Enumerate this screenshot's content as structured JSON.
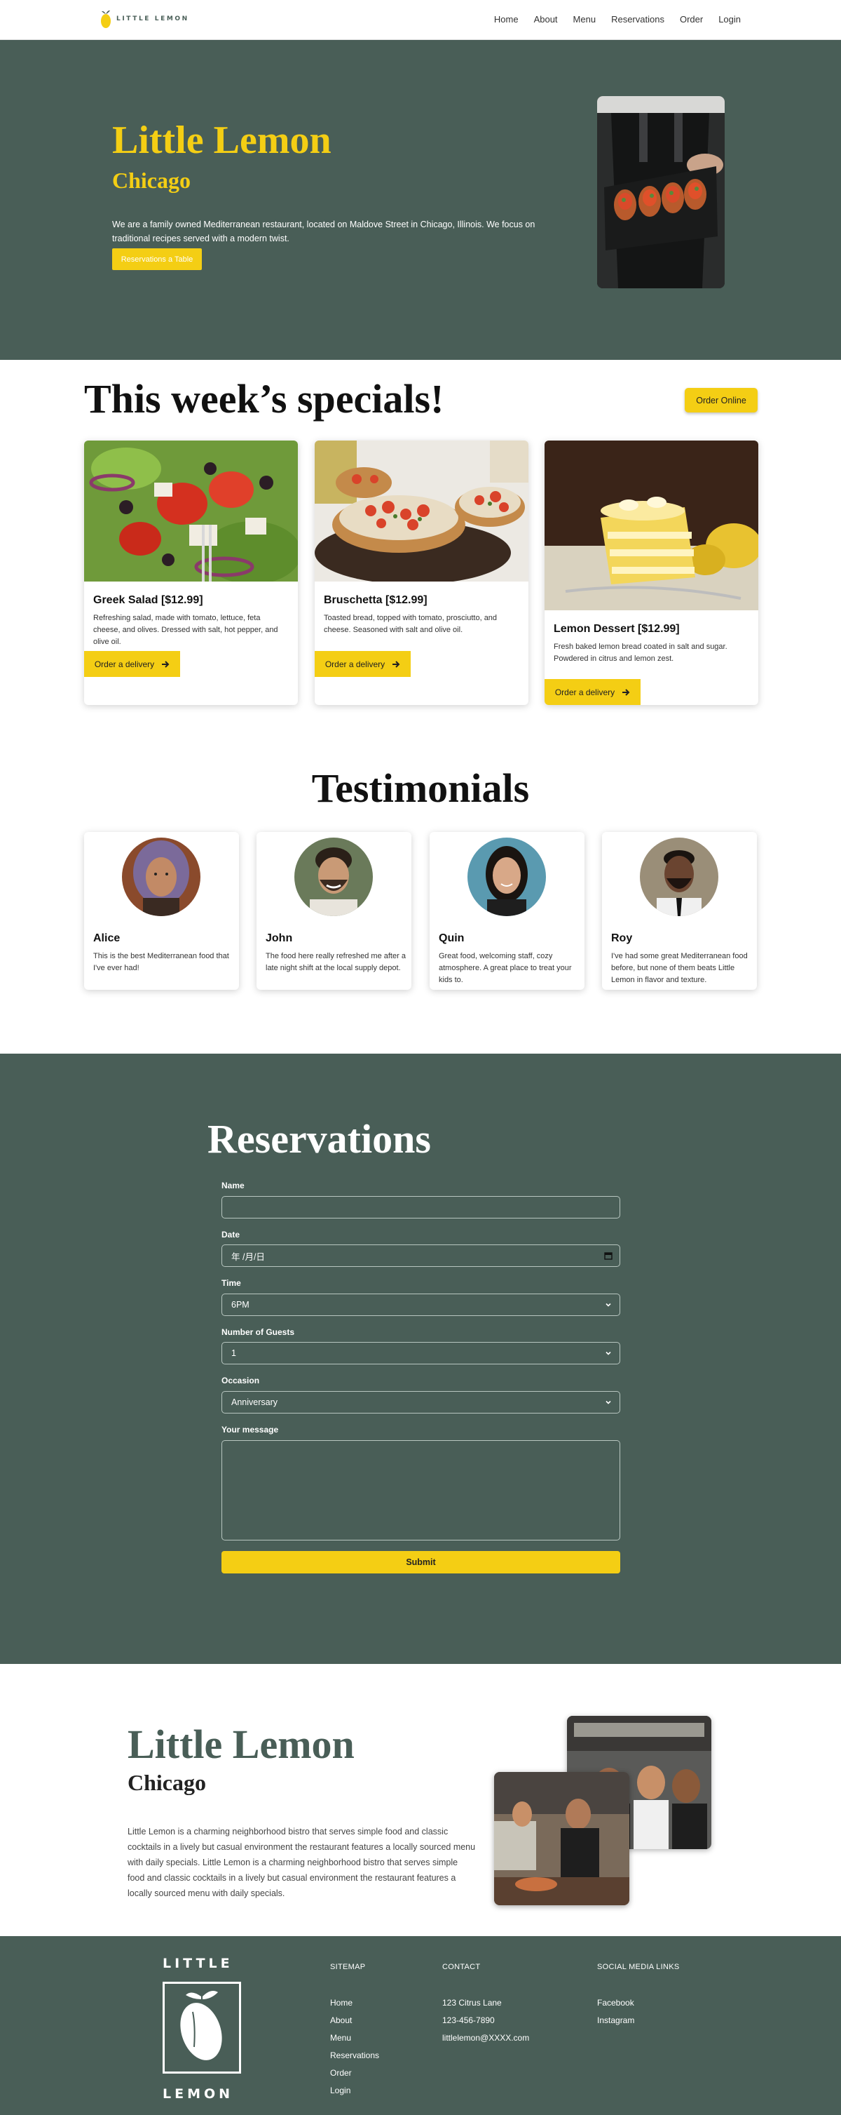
{
  "nav": {
    "logo_text": "LITTLE LEMON",
    "links": [
      "Home",
      "About",
      "Menu",
      "Reservations",
      "Order",
      "Login"
    ]
  },
  "hero": {
    "title": "Little Lemon",
    "subtitle": "Chicago",
    "description": "We are a family owned Mediterranean restaurant, located on Maldove Street in Chicago, Illinois. We focus on traditional recipes served with a modern twist.",
    "cta": "Reservations a Table"
  },
  "specials": {
    "title": "This week’s specials!",
    "order_online": "Order Online",
    "cards": [
      {
        "title": "Greek Salad [$12.99]",
        "description": "Refreshing salad, made with tomato, lettuce, feta cheese, and olives. Dressed with salt, hot pepper, and olive oil.",
        "button": "Order a delivery"
      },
      {
        "title": "Bruschetta [$12.99]",
        "description": "Toasted bread, topped with tomato, prosciutto, and cheese. Seasoned with salt and olive oil.",
        "button": "Order a delivery"
      },
      {
        "title": "Lemon Dessert [$12.99]",
        "description": "Fresh baked lemon bread coated in salt and sugar. Powdered in citrus and lemon zest.",
        "button": "Order a delivery"
      }
    ]
  },
  "testimonials": {
    "title": "Testimonials",
    "items": [
      {
        "name": "Alice",
        "text": "This is the best Mediterranean food that I've ever had!"
      },
      {
        "name": "John",
        "text": "The food here really refreshed me after a late night shift at the local supply depot."
      },
      {
        "name": "Quin",
        "text": "Great food, welcoming staff, cozy atmosphere. A great place to treat your kids to."
      },
      {
        "name": "Roy",
        "text": "I've had some great Mediterranean food before, but none of them beats Little Lemon in flavor and texture."
      }
    ]
  },
  "reservations": {
    "title": "Reservations",
    "name_label": "Name",
    "date_label": "Date",
    "date_placeholder": "年 /月/日",
    "time_label": "Time",
    "time_value": "6PM",
    "guests_label": "Number of Guests",
    "guests_value": "1",
    "occasion_label": "Occasion",
    "occasion_value": "Anniversary",
    "message_label": "Your message",
    "submit": "Submit"
  },
  "about": {
    "title": "Little Lemon",
    "subtitle": "Chicago",
    "description": "Little Lemon is a charming neighborhood bistro that serves simple food and classic cocktails in a lively but casual environment the restaurant features a locally sourced menu with daily specials. Little Lemon is a charming neighborhood bistro that serves simple food and classic cocktails in a lively but casual environment the restaurant features a locally sourced menu with daily specials."
  },
  "footer": {
    "logo_top": "LITTLE",
    "logo_bottom": "LEMON",
    "sitemap_heading": "SITEMAP",
    "sitemap": [
      "Home",
      "About",
      "Menu",
      "Reservations",
      "Order",
      "Login"
    ],
    "contact_heading": "CONTACT",
    "contact": [
      "123 Citrus Lane",
      "123-456-7890",
      "littlelemon@XXXX.com"
    ],
    "social_heading": "SOCIAL MEDIA LINKS",
    "social": [
      "Facebook",
      "Instagram"
    ]
  },
  "colors": {
    "primary_green": "#495e57",
    "primary_yellow": "#f4ce14",
    "white": "#ffffff"
  }
}
